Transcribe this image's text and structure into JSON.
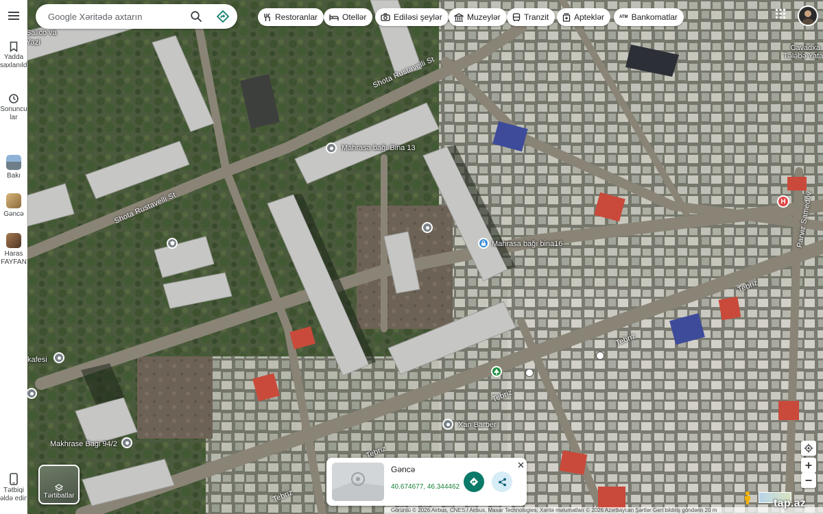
{
  "search": {
    "placeholder": "Google Xəritədə axtarın"
  },
  "chips": [
    {
      "label": "Restoranlar",
      "icon": "fork-knife-icon"
    },
    {
      "label": "Otellər",
      "icon": "bed-icon"
    },
    {
      "label": "Ediləsi şeylər",
      "icon": "camera-icon"
    },
    {
      "label": "Muzeylər",
      "icon": "museum-icon"
    },
    {
      "label": "Tranzit",
      "icon": "bus-icon"
    },
    {
      "label": "Apteklər",
      "icon": "pharmacy-icon"
    },
    {
      "label": "Bankomatlar",
      "icon": "atm-icon",
      "badge": "ATM"
    }
  ],
  "rail": {
    "saved": {
      "label_lines": [
        "Yadda",
        "saxlanıldı"
      ]
    },
    "recent": {
      "label_lines": [
        "Sonuncu",
        "lar"
      ]
    },
    "places": [
      {
        "label": "Bakı"
      },
      {
        "label": "Gəncə"
      },
      {
        "label": "Haras",
        "label2": "FAYFAN"
      }
    ],
    "app": {
      "label_lines": [
        "Tətbiqi",
        "əldə edin"
      ]
    }
  },
  "map_labels": {
    "top_partial": "Şalico va",
    "top_partial2": "Yazi",
    "cavadxan": [
      "Cavadxa",
      "Tələbə Yataq"
    ],
    "mahrasa13": "Mahrasa bağı Bina 13",
    "mahrasa16": "Mahrasa bağı bina16",
    "kafesi": "kafesi",
    "xan_barber": "Xan Barber",
    "makhrase": "Makhrase Bagi 94/2"
  },
  "streets": {
    "rustaveli1": "Shota Rustavelli St",
    "rustaveli2": "Shota Rustavelli St",
    "tebriz1": "Tebriz",
    "tebriz2": "Tebriz",
    "tebriz3": "Tebriz",
    "tebriz4": "Tebriz",
    "tebriz5": "Tebriz",
    "parviz": "Parviz Samedov"
  },
  "layers": {
    "label": "Tərtibatlar"
  },
  "card": {
    "title": "Gəncə",
    "coords": "40.674677, 46.344462"
  },
  "attribution": "Görüntü © 2026 Airbus, CNES / Airbus, Maxar Technologies, Xəritə məlumatları © 2026   Azərbaycan   Şərtlər   Geri bildiriş göndərin   20 m",
  "watermark": "tap.az",
  "colors": {
    "accent_teal": "#0b7a69",
    "coords_green": "#188038",
    "hospital_red": "#e04646",
    "pin_grey": "#7a8288",
    "pin_blue": "#3c8ed8",
    "pin_green": "#1e8e3e"
  }
}
